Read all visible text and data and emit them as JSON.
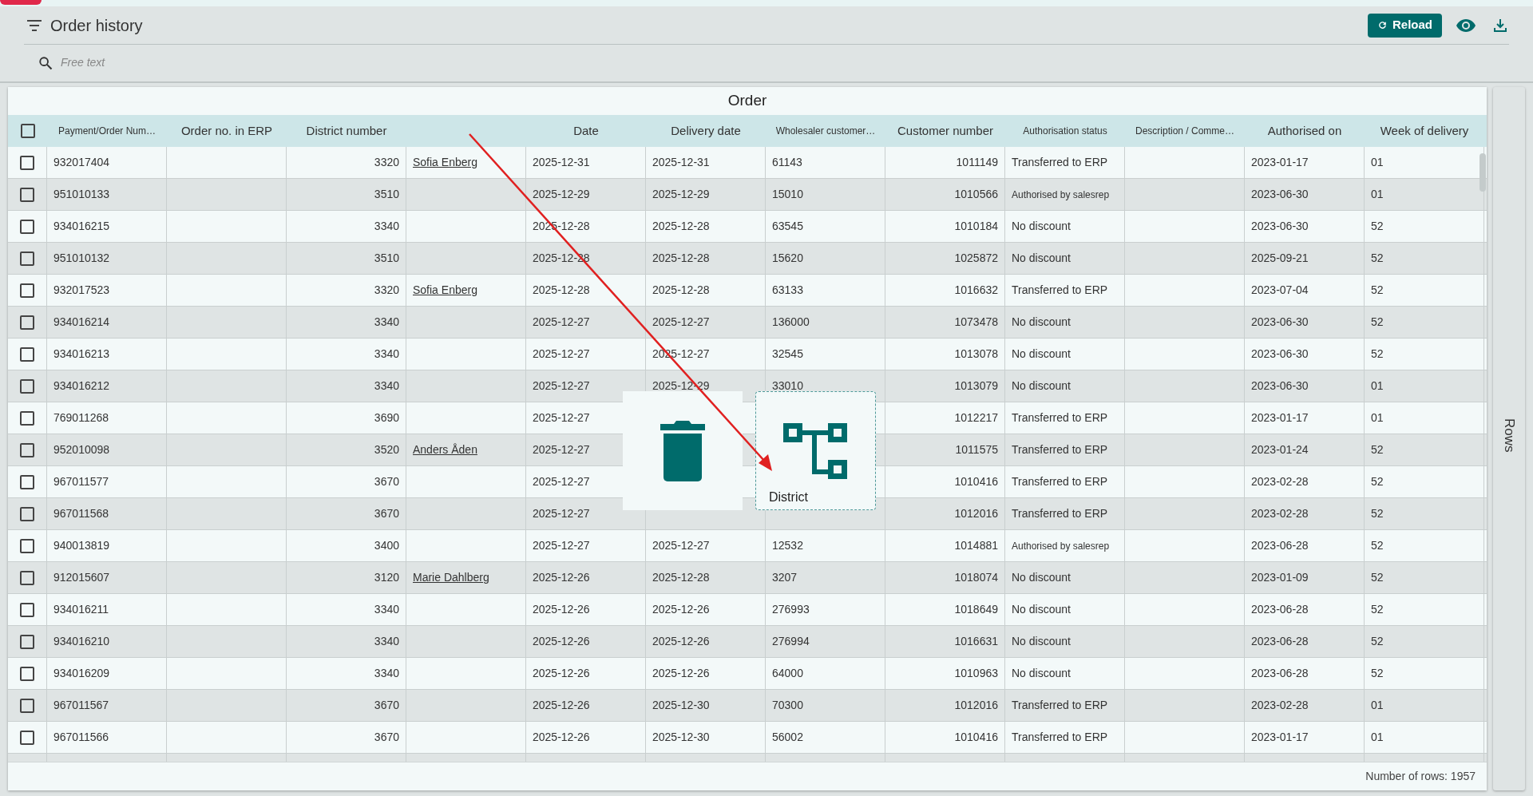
{
  "header": {
    "title": "Order history",
    "reload_button": "Reload"
  },
  "search": {
    "placeholder": "Free text"
  },
  "table": {
    "title": "Order",
    "select_all": {
      "checked": false
    },
    "columns": [
      {
        "label": "Payment/Order Num…",
        "kind": "text"
      },
      {
        "label": "Order no. in ERP",
        "kind": "text"
      },
      {
        "label": "District number",
        "kind": "number"
      },
      {
        "kind": "link"
      },
      {
        "label": "Date",
        "kind": "text"
      },
      {
        "label": "Delivery date",
        "kind": "text"
      },
      {
        "label": "Wholesaler customer…",
        "kind": "text"
      },
      {
        "label": "Customer number",
        "kind": "number"
      },
      {
        "label": "Authorisation status",
        "kind": "text"
      },
      {
        "label": "Description / Comme…",
        "kind": "text"
      },
      {
        "label": "Authorised on",
        "kind": "text"
      },
      {
        "label": "Week of delivery",
        "kind": "text"
      }
    ],
    "rows": [
      {
        "checked": false,
        "cells": [
          "932017404",
          null,
          "3320",
          "Sofia Enberg",
          "2025-12-31",
          "2025-12-31",
          "61143",
          "1011149",
          "Transferred to ERP",
          null,
          "2023-01-17",
          "01"
        ]
      },
      {
        "checked": false,
        "cells": [
          "951010133",
          null,
          "3510",
          null,
          "2025-12-29",
          "2025-12-29",
          "15010",
          "1010566",
          "Authorised by salesrep",
          null,
          "2023-06-30",
          "01"
        ]
      },
      {
        "checked": false,
        "cells": [
          "934016215",
          null,
          "3340",
          null,
          "2025-12-28",
          "2025-12-28",
          "63545",
          "1010184",
          "No discount",
          null,
          "2023-06-30",
          "52"
        ]
      },
      {
        "checked": false,
        "cells": [
          "951010132",
          null,
          "3510",
          null,
          "2025-12-28",
          "2025-12-28",
          "15620",
          "1025872",
          "No discount",
          null,
          "2025-09-21",
          "52"
        ]
      },
      {
        "checked": false,
        "cells": [
          "932017523",
          null,
          "3320",
          "Sofia Enberg",
          "2025-12-28",
          "2025-12-28",
          "63133",
          "1016632",
          "Transferred to ERP",
          null,
          "2023-07-04",
          "52"
        ]
      },
      {
        "checked": false,
        "cells": [
          "934016214",
          null,
          "3340",
          null,
          "2025-12-27",
          "2025-12-27",
          "136000",
          "1073478",
          "No discount",
          null,
          "2023-06-30",
          "52"
        ]
      },
      {
        "checked": false,
        "cells": [
          "934016213",
          null,
          "3340",
          null,
          "2025-12-27",
          "2025-12-27",
          "32545",
          "1013078",
          "No discount",
          null,
          "2023-06-30",
          "52"
        ]
      },
      {
        "checked": false,
        "cells": [
          "934016212",
          null,
          "3340",
          null,
          "2025-12-27",
          "2025-12-29",
          "33010",
          "1013079",
          "No discount",
          null,
          "2023-06-30",
          "01"
        ]
      },
      {
        "checked": false,
        "cells": [
          "769011268",
          null,
          "3690",
          null,
          "2025-12-27",
          null,
          null,
          "1012217",
          "Transferred to ERP",
          null,
          "2023-01-17",
          "01"
        ]
      },
      {
        "checked": false,
        "cells": [
          "952010098",
          null,
          "3520",
          "Anders Åden",
          "2025-12-27",
          null,
          null,
          "1011575",
          "Transferred to ERP",
          null,
          "2023-01-24",
          "52"
        ]
      },
      {
        "checked": false,
        "cells": [
          "967011577",
          null,
          "3670",
          null,
          "2025-12-27",
          null,
          null,
          "1010416",
          "Transferred to ERP",
          null,
          "2023-02-28",
          "52"
        ]
      },
      {
        "checked": false,
        "cells": [
          "967011568",
          null,
          "3670",
          null,
          "2025-12-27",
          null,
          null,
          "1012016",
          "Transferred to ERP",
          null,
          "2023-02-28",
          "52"
        ]
      },
      {
        "checked": false,
        "cells": [
          "940013819",
          null,
          "3400",
          null,
          "2025-12-27",
          "2025-12-27",
          "12532",
          "1014881",
          "Authorised by salesrep",
          null,
          "2023-06-28",
          "52"
        ]
      },
      {
        "checked": false,
        "cells": [
          "912015607",
          null,
          "3120",
          "Marie Dahlberg",
          "2025-12-26",
          "2025-12-28",
          "3207",
          "1018074",
          "No discount",
          null,
          "2023-01-09",
          "52"
        ]
      },
      {
        "checked": false,
        "cells": [
          "934016211",
          null,
          "3340",
          null,
          "2025-12-26",
          "2025-12-26",
          "276993",
          "1018649",
          "No discount",
          null,
          "2023-06-28",
          "52"
        ]
      },
      {
        "checked": false,
        "cells": [
          "934016210",
          null,
          "3340",
          null,
          "2025-12-26",
          "2025-12-26",
          "276994",
          "1016631",
          "No discount",
          null,
          "2023-06-28",
          "52"
        ]
      },
      {
        "checked": false,
        "cells": [
          "934016209",
          null,
          "3340",
          null,
          "2025-12-26",
          "2025-12-26",
          "64000",
          "1010963",
          "No discount",
          null,
          "2023-06-28",
          "52"
        ]
      },
      {
        "checked": false,
        "cells": [
          "967011567",
          null,
          "3670",
          null,
          "2025-12-26",
          "2025-12-30",
          "70300",
          "1012016",
          "Transferred to ERP",
          null,
          "2023-02-28",
          "01"
        ]
      },
      {
        "checked": false,
        "cells": [
          "967011566",
          null,
          "3670",
          null,
          "2025-12-26",
          "2025-12-30",
          "56002",
          "1010416",
          "Transferred to ERP",
          null,
          "2023-01-17",
          "01"
        ]
      }
    ],
    "footer": "Number of rows: 1957"
  },
  "side_tab": "Rows",
  "drag_overlay": {
    "drop_target": "District"
  }
}
